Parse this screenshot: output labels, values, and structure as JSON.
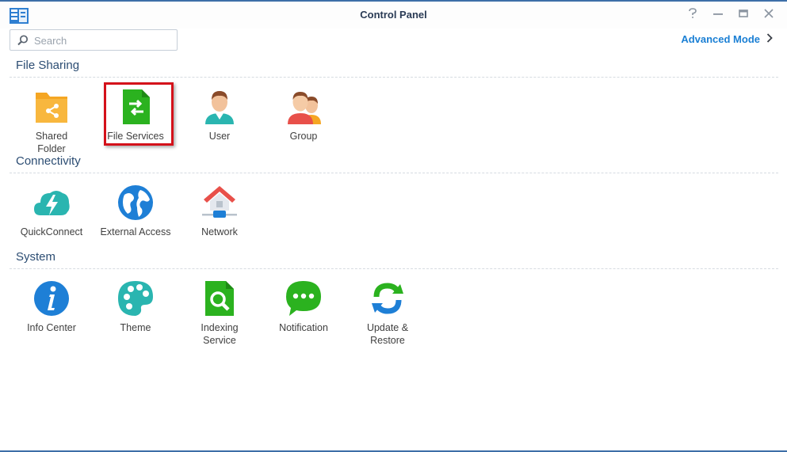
{
  "window": {
    "title": "Control Panel"
  },
  "search": {
    "placeholder": "Search",
    "value": ""
  },
  "advanced_mode": {
    "label": "Advanced Mode"
  },
  "sections": {
    "file_sharing": {
      "title": "File Sharing",
      "items": {
        "shared_folder": {
          "line1": "Shared",
          "line2": "Folder",
          "icon": "shared-folder-icon"
        },
        "file_services": {
          "line1": "File Services",
          "icon": "file-services-icon",
          "highlighted": true
        },
        "user": {
          "line1": "User",
          "icon": "user-icon"
        },
        "group": {
          "line1": "Group",
          "icon": "group-icon"
        }
      }
    },
    "connectivity": {
      "title": "Connectivity",
      "items": {
        "quickconnect": {
          "line1": "QuickConnect",
          "icon": "quickconnect-icon"
        },
        "external_access": {
          "line1": "External Access",
          "icon": "globe-icon"
        },
        "network": {
          "line1": "Network",
          "icon": "network-icon"
        }
      }
    },
    "system": {
      "title": "System",
      "items": {
        "info_center": {
          "line1": "Info Center",
          "icon": "info-icon"
        },
        "theme": {
          "line1": "Theme",
          "icon": "palette-icon"
        },
        "indexing_service": {
          "line1": "Indexing",
          "line2": "Service",
          "icon": "indexing-icon"
        },
        "notification": {
          "line1": "Notification",
          "icon": "chat-bubble-icon"
        },
        "update_restore": {
          "line1": "Update &",
          "line2": "Restore",
          "icon": "refresh-icon"
        }
      }
    }
  },
  "colors": {
    "accent": "#1a7fd4",
    "section_title": "#2c4d73",
    "highlight": "#d4111a",
    "folder": "#f5a623",
    "green": "#2bb21f",
    "teal": "#2ab5b0",
    "blue": "#1e7fd6"
  }
}
